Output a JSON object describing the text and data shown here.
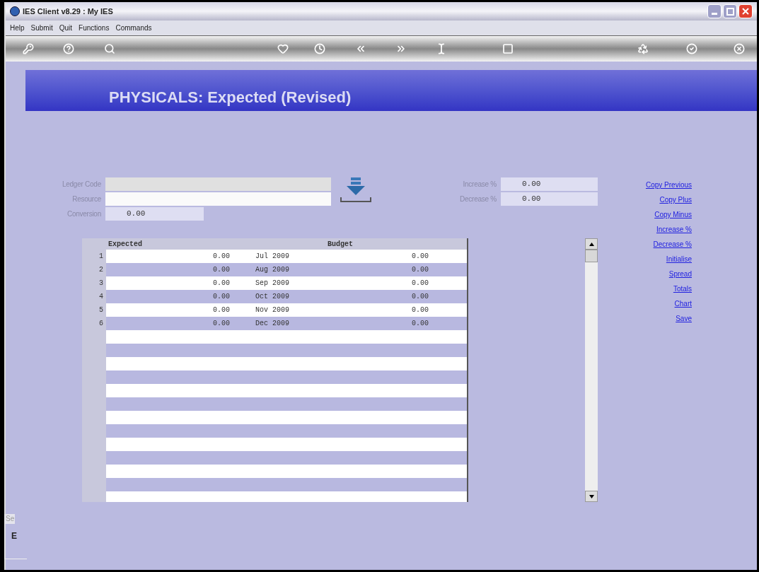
{
  "window": {
    "title": "IES Client v8.29 : My IES"
  },
  "menu": [
    "Help",
    "Submit",
    "Quit",
    "Functions",
    "Commands"
  ],
  "header": {
    "title": "PHYSICALS: Expected (Revised)"
  },
  "form": {
    "ledger_code": {
      "label": "Ledger Code"
    },
    "resource": {
      "label": "Resource"
    },
    "conversion": {
      "label": "Conversion",
      "value": "0.00"
    },
    "increase": {
      "label": "Increase %",
      "value": "0.00"
    },
    "decrease": {
      "label": "Decrease %",
      "value": "0.00"
    }
  },
  "actions": [
    "Copy Previous",
    "Copy Plus",
    "Copy Minus",
    "Increase %",
    "Decrease %",
    "Initialise",
    "Spread",
    "Totals",
    "Chart",
    "Save"
  ],
  "table": {
    "columns": [
      "Expected",
      "Budget"
    ],
    "rows": [
      {
        "number": "1",
        "expected": "0.00",
        "period": "Jul 2009",
        "budget": "0.00"
      },
      {
        "number": "2",
        "expected": "0.00",
        "period": "Aug 2009",
        "budget": "0.00"
      },
      {
        "number": "3",
        "expected": "0.00",
        "period": "Sep 2009",
        "budget": "0.00"
      },
      {
        "number": "4",
        "expected": "0.00",
        "period": "Oct 2009",
        "budget": "0.00"
      },
      {
        "number": "5",
        "expected": "0.00",
        "period": "Nov 2009",
        "budget": "0.00"
      },
      {
        "number": "6",
        "expected": "0.00",
        "period": "Dec 2009",
        "budget": "0.00"
      }
    ]
  },
  "side_panel": {
    "tab": "Se",
    "letter": "E"
  }
}
